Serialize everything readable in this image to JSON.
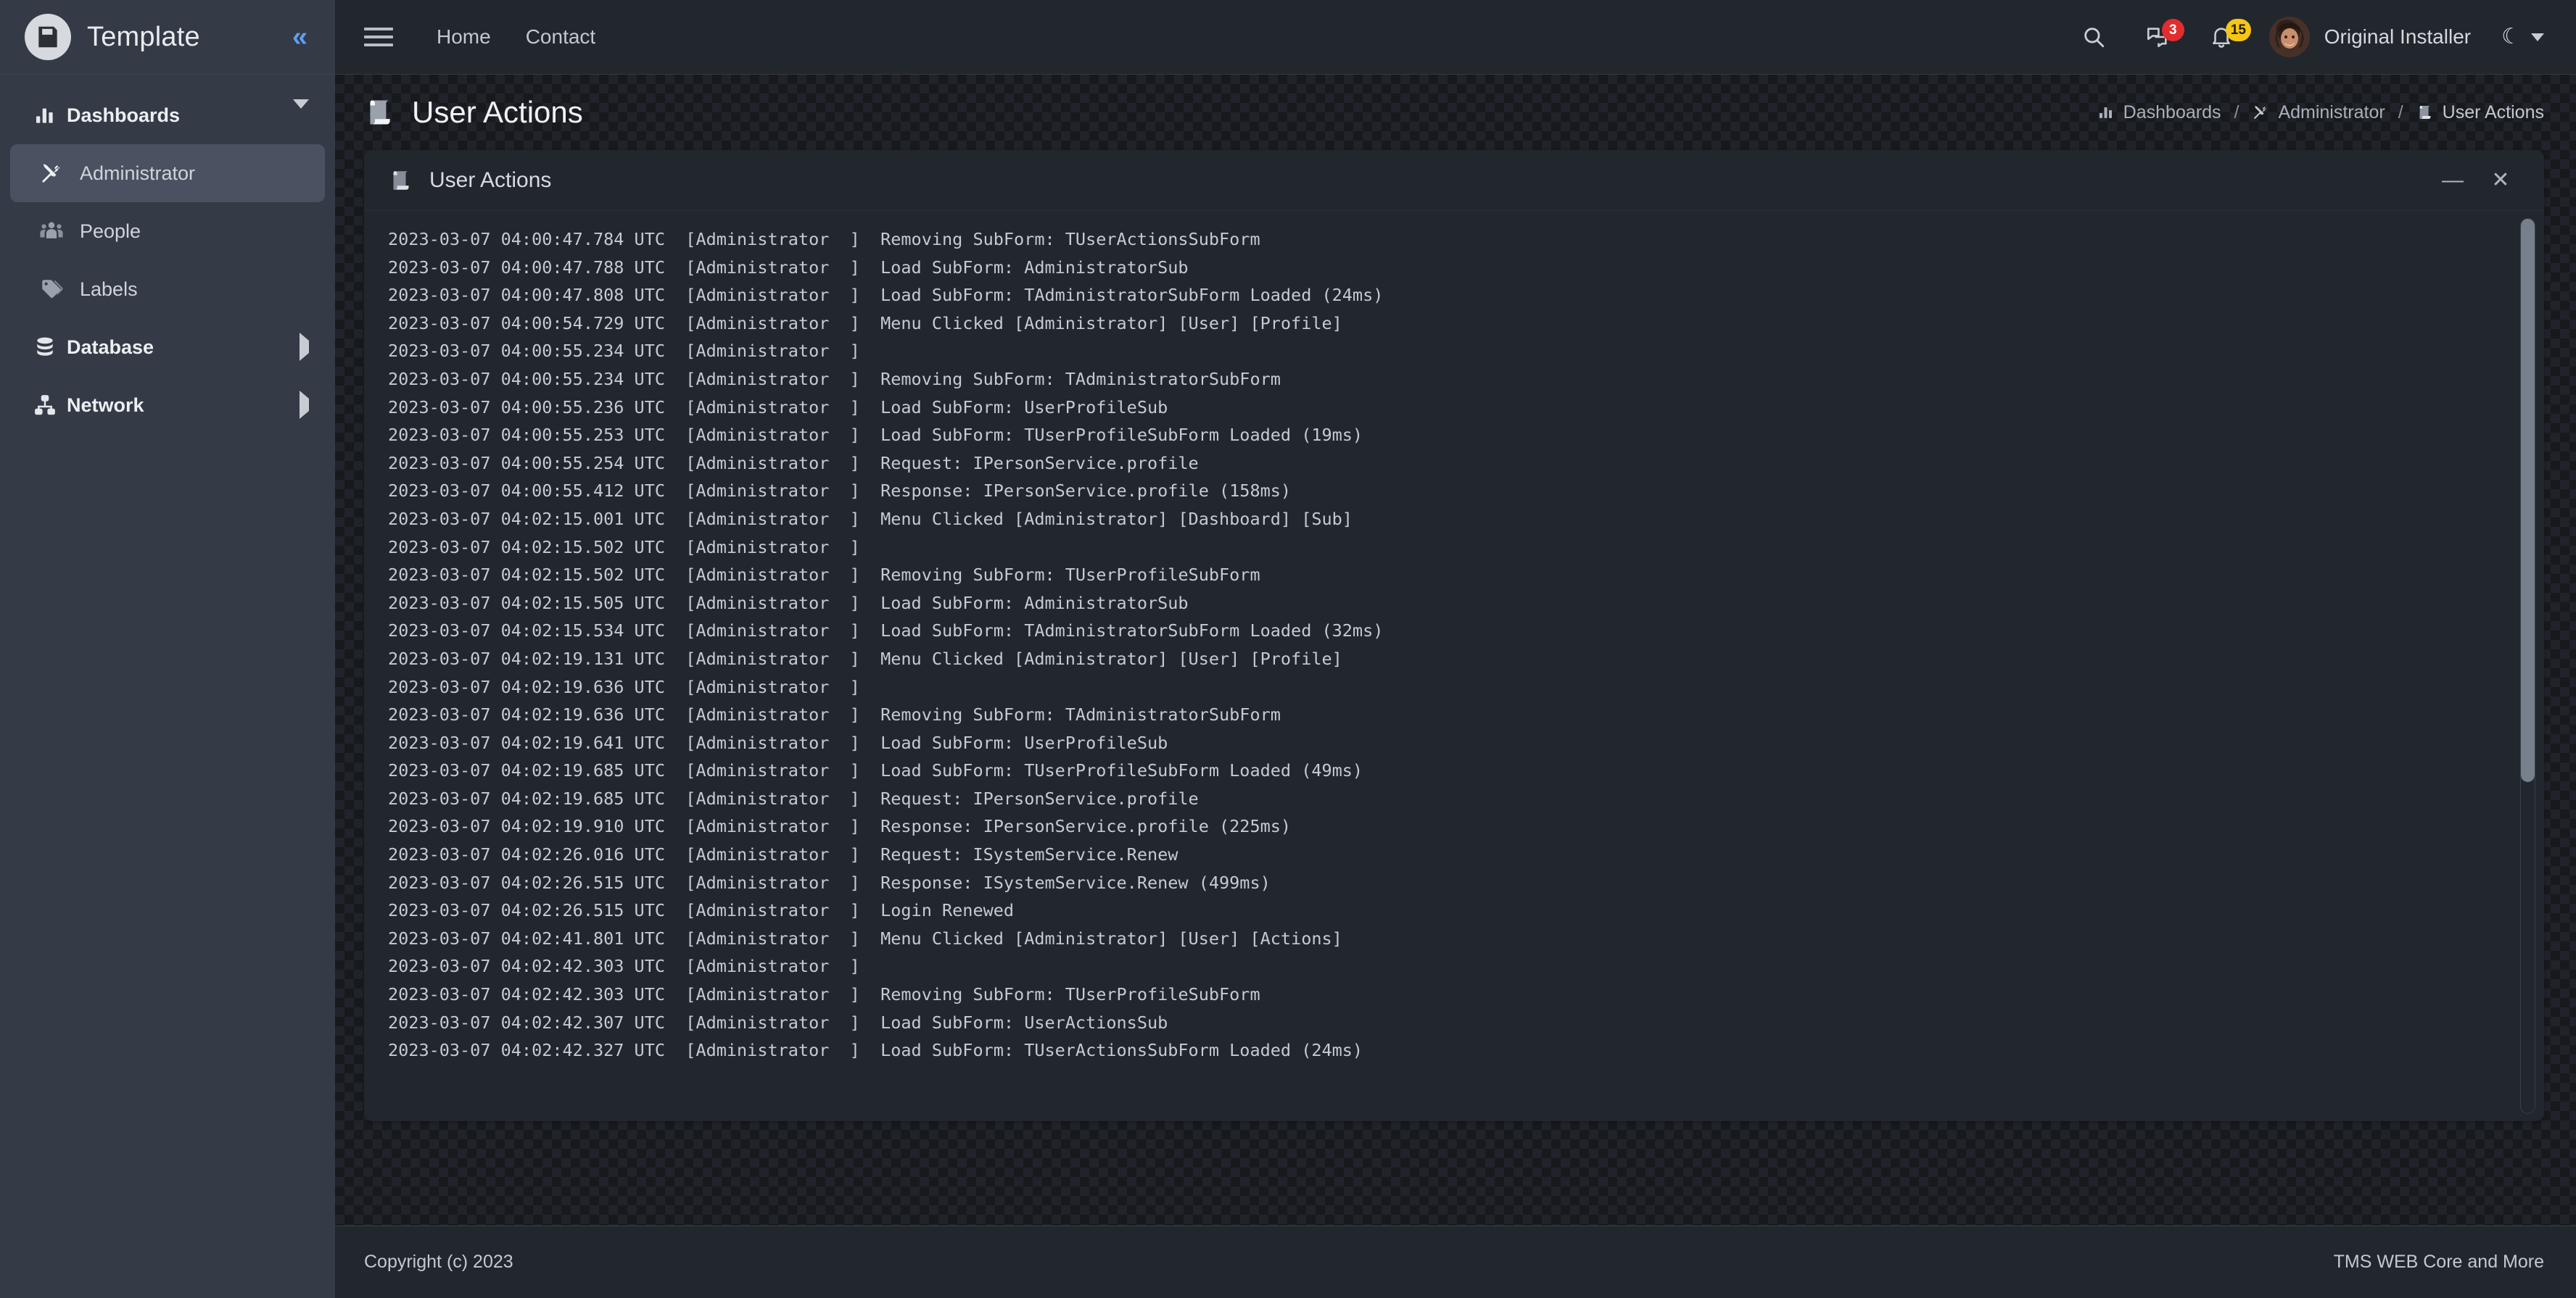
{
  "brand": {
    "logo_icon": "save-disk-icon",
    "title": "Template",
    "collapse_icon": "chevron-double-left-icon",
    "collapse_label": "«"
  },
  "topnav": {
    "menu_icon": "hamburger-menu-icon",
    "links": [
      {
        "label": "Home",
        "name": "home"
      },
      {
        "label": "Contact",
        "name": "contact"
      }
    ],
    "search_icon": "search-icon",
    "messages_icon": "comments-icon",
    "messages_badge": "3",
    "notifications_icon": "bell-icon",
    "notifications_badge": "15",
    "avatar_icon": "user-avatar",
    "user_name": "Original Installer",
    "theme_icon": "moon-icon",
    "theme_glyph": "☾",
    "theme_caret_icon": "caret-down-icon"
  },
  "sidebar": {
    "items": [
      {
        "label": "Dashboards",
        "icon": "chart-bars-icon",
        "type": "group",
        "expanded": true,
        "active": false
      },
      {
        "label": "Administrator",
        "icon": "tools-icon",
        "type": "child",
        "active": true
      },
      {
        "label": "People",
        "icon": "people-group-icon",
        "type": "child",
        "active": false
      },
      {
        "label": "Labels",
        "icon": "tag-icon",
        "type": "child",
        "active": false
      },
      {
        "label": "Database",
        "icon": "database-icon",
        "type": "group",
        "expanded": false,
        "active": false
      },
      {
        "label": "Network",
        "icon": "sitemap-icon",
        "type": "group",
        "expanded": false,
        "active": false
      }
    ]
  },
  "page": {
    "title": "User Actions",
    "title_icon": "scroll-icon",
    "breadcrumb": [
      {
        "label": "Dashboards",
        "icon": "chart-bars-icon"
      },
      {
        "label": "Administrator",
        "icon": "tools-icon"
      },
      {
        "label": "User Actions",
        "icon": "scroll-icon"
      }
    ],
    "breadcrumb_separator": "/"
  },
  "card": {
    "title": "User Actions",
    "title_icon": "scroll-icon",
    "minimize_icon": "minimize-icon",
    "minimize_glyph": "—",
    "close_icon": "close-icon",
    "close_glyph": "✕",
    "scroll_thumb_percent": 63,
    "log_lines": [
      "2023-03-07 04:00:47.784 UTC  [Administrator  ]  Removing SubForm: TUserActionsSubForm",
      "2023-03-07 04:00:47.788 UTC  [Administrator  ]  Load SubForm: AdministratorSub",
      "2023-03-07 04:00:47.808 UTC  [Administrator  ]  Load SubForm: TAdministratorSubForm Loaded (24ms)",
      "2023-03-07 04:00:54.729 UTC  [Administrator  ]  Menu Clicked [Administrator] [User] [Profile]",
      "2023-03-07 04:00:55.234 UTC  [Administrator  ]",
      "2023-03-07 04:00:55.234 UTC  [Administrator  ]  Removing SubForm: TAdministratorSubForm",
      "2023-03-07 04:00:55.236 UTC  [Administrator  ]  Load SubForm: UserProfileSub",
      "2023-03-07 04:00:55.253 UTC  [Administrator  ]  Load SubForm: TUserProfileSubForm Loaded (19ms)",
      "2023-03-07 04:00:55.254 UTC  [Administrator  ]  Request: IPersonService.profile",
      "2023-03-07 04:00:55.412 UTC  [Administrator  ]  Response: IPersonService.profile (158ms)",
      "2023-03-07 04:02:15.001 UTC  [Administrator  ]  Menu Clicked [Administrator] [Dashboard] [Sub]",
      "2023-03-07 04:02:15.502 UTC  [Administrator  ]",
      "2023-03-07 04:02:15.502 UTC  [Administrator  ]  Removing SubForm: TUserProfileSubForm",
      "2023-03-07 04:02:15.505 UTC  [Administrator  ]  Load SubForm: AdministratorSub",
      "2023-03-07 04:02:15.534 UTC  [Administrator  ]  Load SubForm: TAdministratorSubForm Loaded (32ms)",
      "2023-03-07 04:02:19.131 UTC  [Administrator  ]  Menu Clicked [Administrator] [User] [Profile]",
      "2023-03-07 04:02:19.636 UTC  [Administrator  ]",
      "2023-03-07 04:02:19.636 UTC  [Administrator  ]  Removing SubForm: TAdministratorSubForm",
      "2023-03-07 04:02:19.641 UTC  [Administrator  ]  Load SubForm: UserProfileSub",
      "2023-03-07 04:02:19.685 UTC  [Administrator  ]  Load SubForm: TUserProfileSubForm Loaded (49ms)",
      "2023-03-07 04:02:19.685 UTC  [Administrator  ]  Request: IPersonService.profile",
      "2023-03-07 04:02:19.910 UTC  [Administrator  ]  Response: IPersonService.profile (225ms)",
      "2023-03-07 04:02:26.016 UTC  [Administrator  ]  Request: ISystemService.Renew",
      "2023-03-07 04:02:26.515 UTC  [Administrator  ]  Response: ISystemService.Renew (499ms)",
      "2023-03-07 04:02:26.515 UTC  [Administrator  ]  Login Renewed",
      "2023-03-07 04:02:41.801 UTC  [Administrator  ]  Menu Clicked [Administrator] [User] [Actions]",
      "2023-03-07 04:02:42.303 UTC  [Administrator  ]",
      "2023-03-07 04:02:42.303 UTC  [Administrator  ]  Removing SubForm: TUserProfileSubForm",
      "2023-03-07 04:02:42.307 UTC  [Administrator  ]  Load SubForm: UserActionsSub",
      "2023-03-07 04:02:42.327 UTC  [Administrator  ]  Load SubForm: TUserActionsSubForm Loaded (24ms)"
    ]
  },
  "footer": {
    "copyright": "Copyright (c) 2023",
    "product": "TMS WEB Core and More"
  },
  "colors": {
    "sidebar_bg": "#343a46",
    "topnav_bg": "#22262d",
    "card_bg": "#22262d",
    "main_bg": "#17191d",
    "accent_blue": "#5f9ff0",
    "badge_red": "#e02d2d",
    "badge_yellow": "#f5c518",
    "active_item_bg": "#4a5160",
    "text_primary": "#e9ebee",
    "log_text": "#c6cbd3"
  }
}
